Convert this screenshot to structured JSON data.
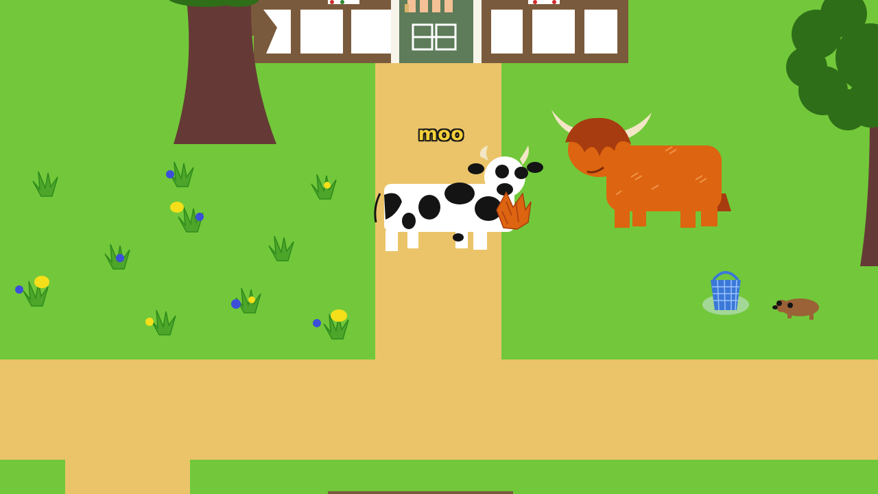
{
  "game": {
    "speech_text": "moo",
    "colors": {
      "grass": "#72c83a",
      "path": "#ebc46a",
      "tree_trunk": "#653a36",
      "tree_leaves": "#2e6e18",
      "house_timber": "#7a5a3c",
      "house_wall": "#ffffff",
      "door": "#5e7b5a",
      "cow_black": "#141414",
      "cow_white": "#ffffff",
      "highland_cow": "#dd6410",
      "highland_hair": "#a73c10",
      "horn": "#f3e6c6",
      "basket": "#3a78d8",
      "dandelion": "#f5df1a",
      "cornflower": "#3c4fd8",
      "mole": "#9a6236"
    },
    "characters": [
      {
        "name": "holstein-cow",
        "icon": "cow-icon"
      },
      {
        "name": "highland-cow",
        "icon": "highland-cow-icon"
      },
      {
        "name": "mole",
        "icon": "mole-icon"
      }
    ],
    "items": [
      {
        "name": "blue-basket",
        "icon": "basket-icon"
      },
      {
        "name": "hay-bundle",
        "icon": "hay-icon"
      }
    ]
  }
}
